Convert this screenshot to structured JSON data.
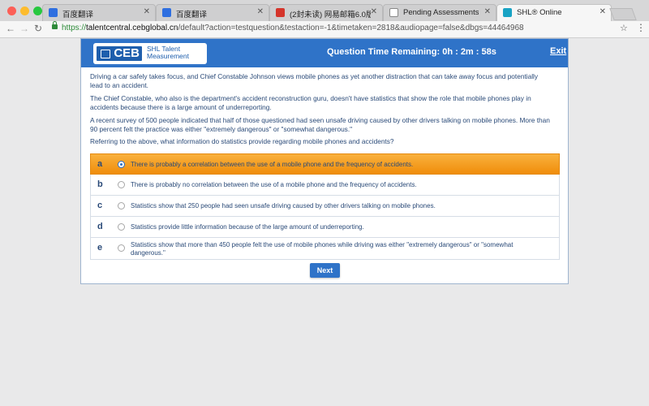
{
  "browser": {
    "tabs": [
      {
        "title": "百度翻译",
        "color": "#2f6fe0"
      },
      {
        "title": "百度翻译",
        "color": "#2f6fe0"
      },
      {
        "title": "(2封未读) 网易邮箱6.0版",
        "color": "#d5352b"
      },
      {
        "title": "Pending Assessments",
        "color": "#888888"
      },
      {
        "title": "SHL® Online",
        "color": "#19a3c4",
        "active": true
      }
    ],
    "url_scheme": "https://",
    "url_host": "talentcentral.cebglobal.cn",
    "url_path": "/default?action=testquestion&testaction=-1&timetaken=2818&audiopage=false&dbgs=44464968"
  },
  "header": {
    "logo_main": "CEB",
    "logo_sub_line1": "SHL Talent",
    "logo_sub_line2": "Measurement",
    "timer": "Question Time Remaining: 0h : 2m : 58s",
    "exit_label": "Exit"
  },
  "question": {
    "paragraphs": [
      "Driving a car safely takes focus, and Chief Constable Johnson views mobile phones as yet another distraction that can take away focus and potentially lead to an accident.",
      "The Chief Constable, who also is the department's accident reconstruction guru, doesn't have statistics that show the role that mobile phones play in accidents because there is a large amount of underreporting.",
      "A recent survey of 500 people indicated that half of those questioned had seen unsafe driving caused by other drivers talking on mobile phones. More than 90 percent felt the practice was either \"extremely dangerous\" or \"somewhat dangerous.\"",
      "Referring to the above, what information do statistics provide regarding mobile phones and accidents?"
    ],
    "options": [
      {
        "letter": "a",
        "text": "There is probably a correlation between the use of a mobile phone and the frequency of accidents.",
        "selected": true
      },
      {
        "letter": "b",
        "text": "There is probably no correlation between the use of a mobile phone and the frequency of accidents."
      },
      {
        "letter": "c",
        "text": "Statistics show that 250 people had seen unsafe driving caused by other drivers talking on mobile phones."
      },
      {
        "letter": "d",
        "text": "Statistics provide little information because of the large amount of underreporting."
      },
      {
        "letter": "e",
        "text": "Statistics show that more than 450 people felt the use of mobile phones while driving was either \"extremely dangerous\" or \"somewhat dangerous.\""
      }
    ],
    "next_label": "Next"
  },
  "colors": {
    "brand_blue": "#2f73c8",
    "selected_orange": "#f39a1e",
    "text_navy": "#2a4a78"
  }
}
